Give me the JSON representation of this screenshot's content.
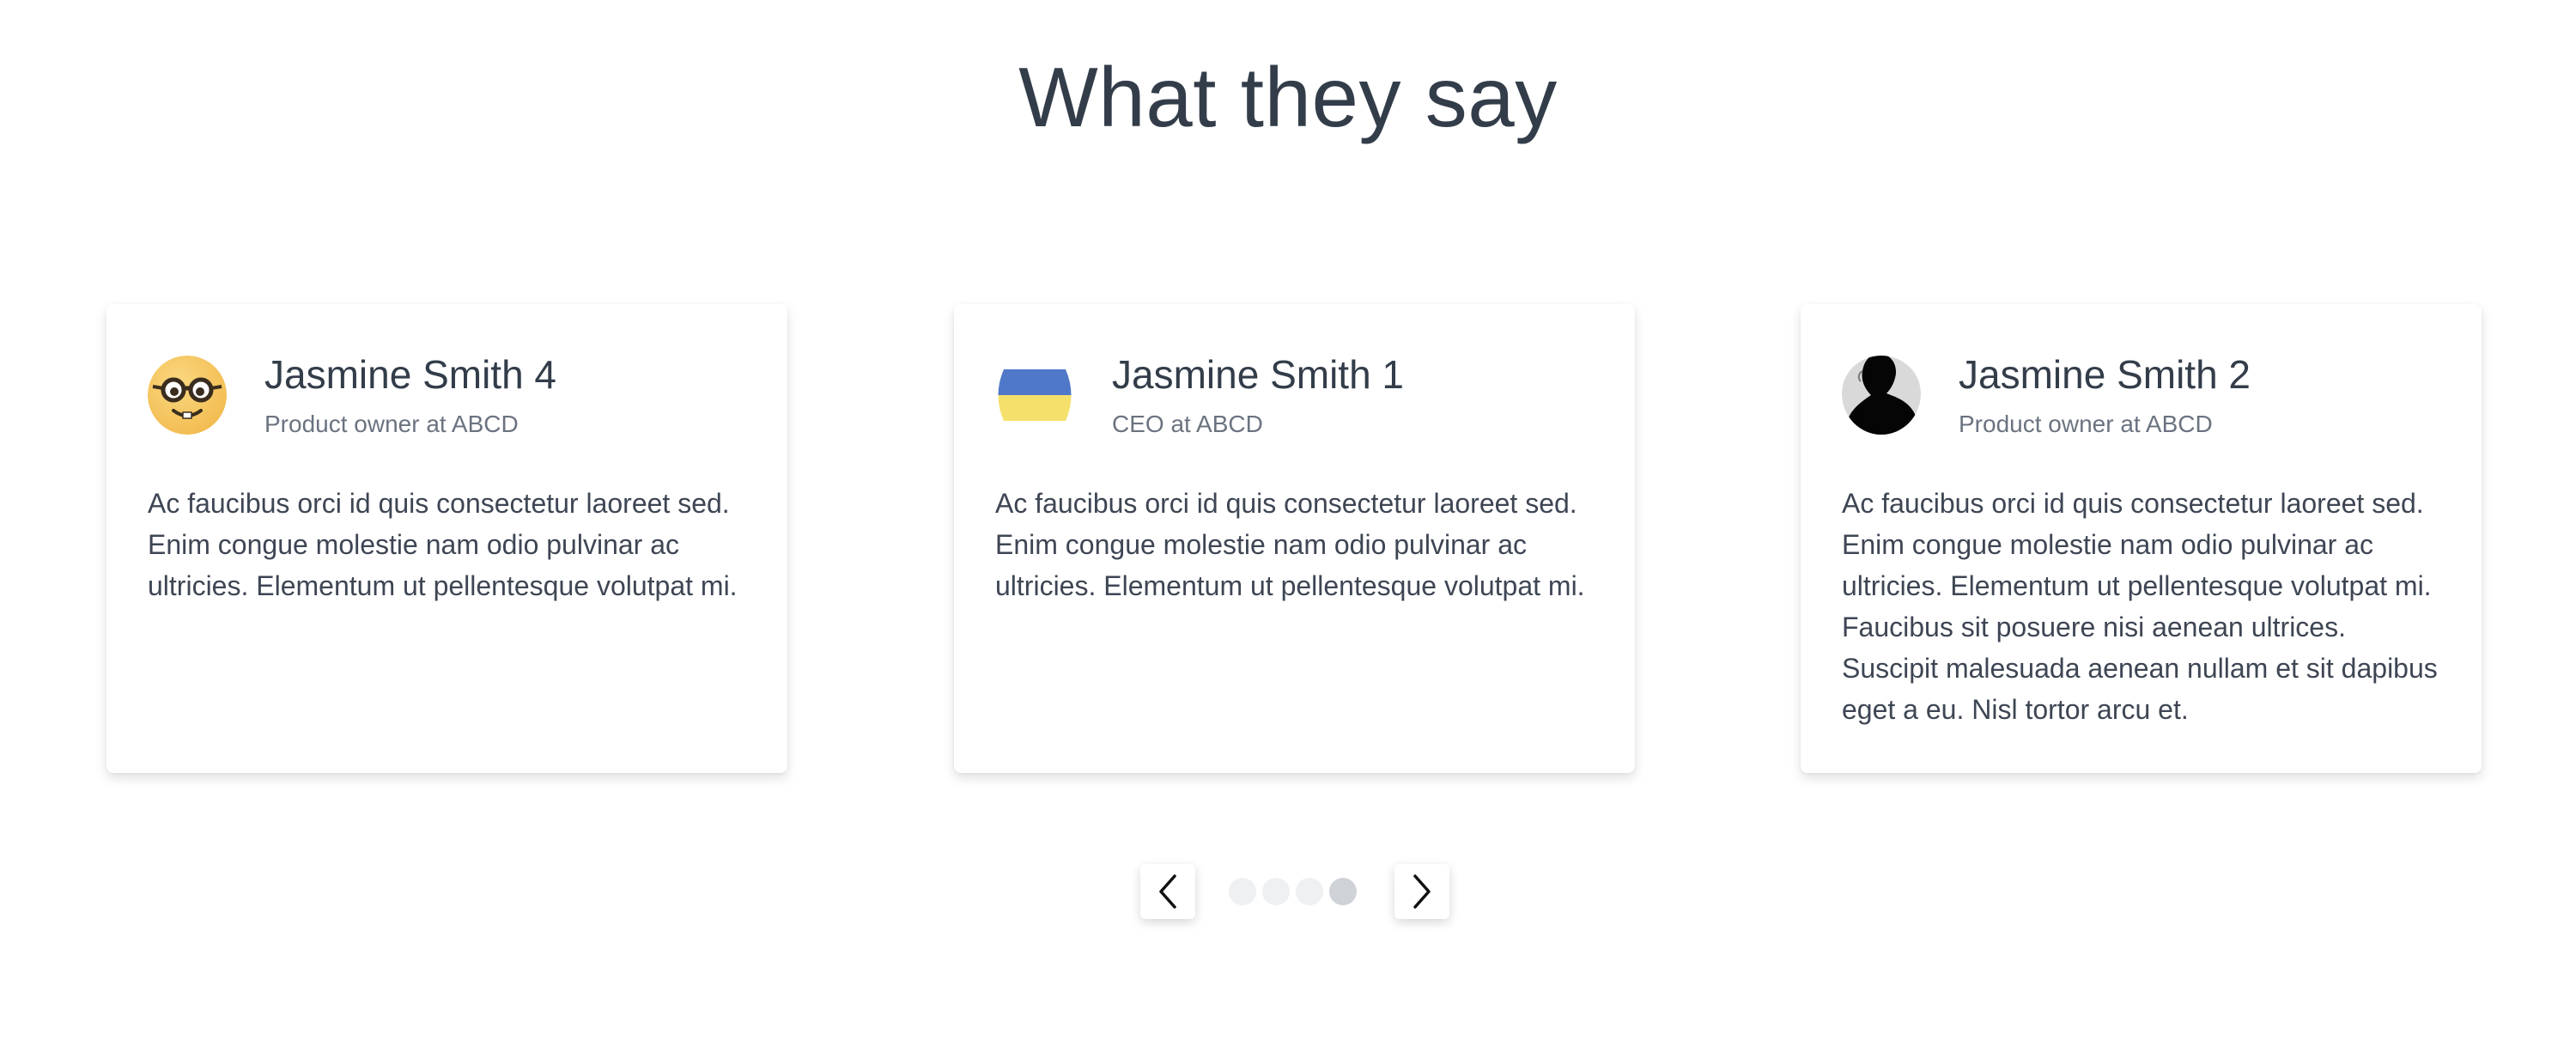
{
  "section": {
    "title": "What they say"
  },
  "testimonials": [
    {
      "name": "Jasmine Smith 4",
      "role": "Product owner at ABCD",
      "avatar_icon": "nerd-face-emoji",
      "text": "Ac faucibus orci id quis consectetur laoreet sed. Enim congue molestie nam odio pulvinar ac ultricies. Elementum ut pellentesque volutpat mi."
    },
    {
      "name": "Jasmine Smith 1",
      "role": "CEO at ABCD",
      "avatar_icon": "blue-yellow-flag",
      "text": "Ac faucibus orci id quis consectetur laoreet sed. Enim congue molestie nam odio pulvinar ac ultricies. Elementum ut pellentesque volutpat mi."
    },
    {
      "name": "Jasmine Smith 2",
      "role": "Product owner at ABCD",
      "avatar_icon": "person-silhouette",
      "text": "Ac faucibus orci id quis consectetur laoreet sed. Enim congue molestie nam odio pulvinar ac ultricies. Elementum ut pellentesque volutpat mi. Faucibus sit posuere nisi aenean ultrices. Suscipit malesuada aenean nullam et sit dapibus eget a eu. Nisl tortor arcu et."
    }
  ],
  "carousel": {
    "prev_icon": "chevron-left-icon",
    "next_icon": "chevron-right-icon",
    "dot_count": 4,
    "active_dot": 4
  },
  "colors": {
    "heading": "#333d4a",
    "role": "#6b7380",
    "dot_inactive": "#eef0f2",
    "dot_active": "#cfd3d8",
    "flag_blue": "#4f78c9",
    "flag_yellow": "#f5e06b"
  }
}
